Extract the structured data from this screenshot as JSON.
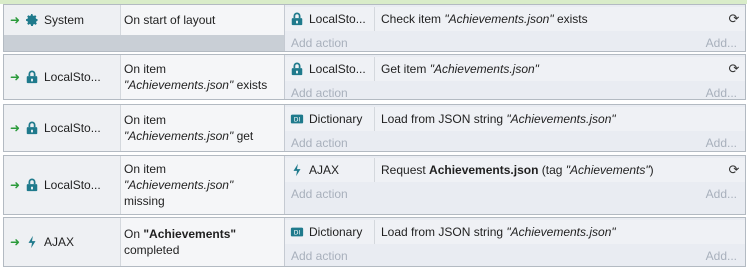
{
  "events": [
    {
      "object": "System",
      "object_icon": "gear-icon",
      "condition_lines": [
        "On start of layout"
      ],
      "action": {
        "object": "LocalSto...",
        "object_icon": "localstorage-icon",
        "text_parts": [
          "Check item ",
          "\"Achievements.json\"",
          " exists"
        ],
        "styles": [
          "n",
          "i",
          "n"
        ],
        "wait": true
      },
      "add_action": "Add action",
      "add_short": "Add..."
    },
    {
      "object": "LocalSto...",
      "object_icon": "localstorage-icon",
      "condition_lines": [
        "On item",
        "\"Achievements.json\" exists"
      ],
      "action": {
        "object": "LocalSto...",
        "object_icon": "localstorage-icon",
        "text_parts": [
          "Get item ",
          "\"Achievements.json\""
        ],
        "styles": [
          "n",
          "i"
        ],
        "wait": true
      },
      "add_action": "Add action",
      "add_short": "Add..."
    },
    {
      "object": "LocalSto...",
      "object_icon": "localstorage-icon",
      "condition_lines": [
        "On item",
        "\"Achievements.json\" get"
      ],
      "action": {
        "object": "Dictionary",
        "object_icon": "dictionary-icon",
        "text_parts": [
          "Load from JSON string ",
          "\"Achievements.json\""
        ],
        "styles": [
          "n",
          "i"
        ],
        "wait": false
      },
      "add_action": "Add action",
      "add_short": "Add..."
    },
    {
      "object": "LocalSto...",
      "object_icon": "localstorage-icon",
      "condition_lines": [
        "On item",
        "\"Achievements.json\"",
        "missing"
      ],
      "action": {
        "object": "AJAX",
        "object_icon": "ajax-icon",
        "text_parts": [
          "Request ",
          "Achievements.json",
          " (tag ",
          "\"Achievements\"",
          ")"
        ],
        "styles": [
          "n",
          "b",
          "n",
          "i",
          "n"
        ],
        "wait": true
      },
      "add_action": "Add action",
      "add_short": "Add..."
    },
    {
      "object": "AJAX",
      "object_icon": "ajax-icon",
      "condition_lines": [
        "On \"Achievements\"",
        "completed"
      ],
      "action": {
        "object": "Dictionary",
        "object_icon": "dictionary-icon",
        "text_parts": [
          "Load from JSON string ",
          "\"Achievements.json\""
        ],
        "styles": [
          "n",
          "i"
        ],
        "wait": false
      },
      "add_action": "Add action",
      "add_short": "Add..."
    }
  ],
  "colors": {
    "trigger_arrow": "#2a9a3a",
    "icon_teal": "#1f7a8c"
  }
}
